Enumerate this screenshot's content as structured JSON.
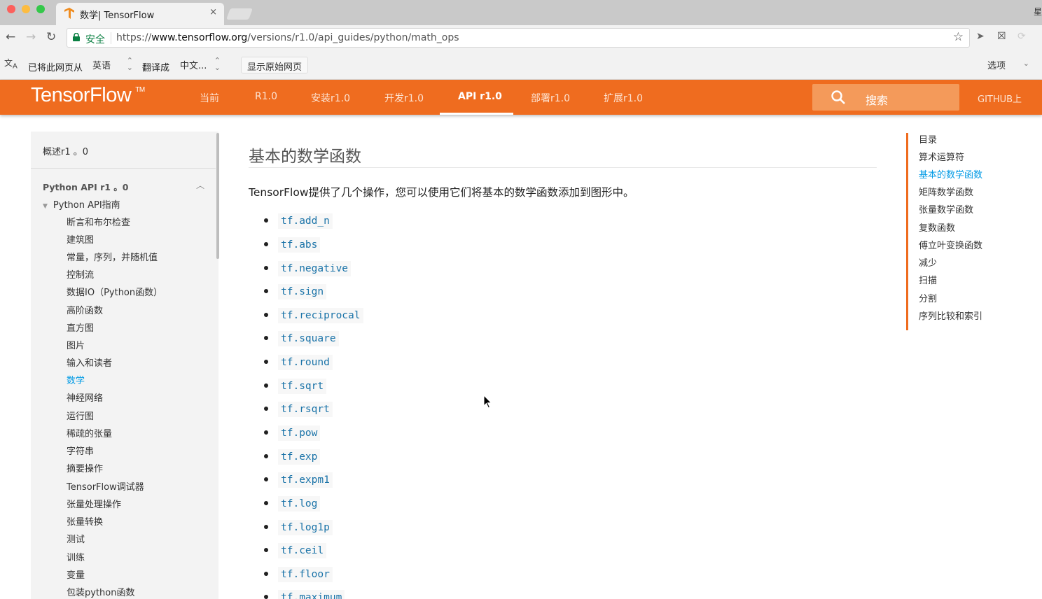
{
  "browser": {
    "tab_title": "数学| TensorFlow",
    "tab_close": "×",
    "corner_text": "星",
    "secure_label": "安全",
    "url_https": "https://",
    "url_domain": "www.tensorflow.org",
    "url_path": "/versions/r1.0/api_guides/python/math_ops",
    "star": "☆"
  },
  "translate_bar": {
    "prefix": "已将此网页从",
    "from_lang": "英语",
    "middle": "翻译成",
    "to_lang": "中文...",
    "show_original": "显示原始网页",
    "options": "选项"
  },
  "header": {
    "logo": "TensorFlow",
    "tm": "TM",
    "nav": [
      {
        "label": "当前"
      },
      {
        "label": "R1.0"
      },
      {
        "label": "安装r1.0"
      },
      {
        "label": "开发r1.0"
      },
      {
        "label": "API r1.0"
      },
      {
        "label": "部署r1.0"
      },
      {
        "label": "扩展r1.0"
      }
    ],
    "active_nav": "API r1.0",
    "search_placeholder": "搜索",
    "github": "GITHUB上"
  },
  "sidebar": {
    "overview": "概述r1 。0",
    "section": "Python API r1 。0",
    "guide": "Python API指南",
    "items": [
      "断言和布尔检查",
      "建筑图",
      "常量，序列，并随机值",
      "控制流",
      "数据IO（Python函数）",
      "高阶函数",
      "直方图",
      "图片",
      "输入和读者",
      "数学",
      "神经网络",
      "运行图",
      "稀疏的张量",
      "字符串",
      "摘要操作",
      "TensorFlow调试器",
      "张量处理操作",
      "张量转换",
      "测试",
      "训练",
      "变量",
      "包装python函数"
    ],
    "active_item": "数学"
  },
  "main": {
    "title": "基本的数学函数",
    "intro": "TensorFlow提供了几个操作，您可以使用它们将基本的数学函数添加到图形中。",
    "functions": [
      "tf.add_n",
      "tf.abs",
      "tf.negative",
      "tf.sign",
      "tf.reciprocal",
      "tf.square",
      "tf.round",
      "tf.sqrt",
      "tf.rsqrt",
      "tf.pow",
      "tf.exp",
      "tf.expm1",
      "tf.log",
      "tf.log1p",
      "tf.ceil",
      "tf.floor",
      "tf.maximum"
    ]
  },
  "toc": {
    "items": [
      "目录",
      "算术运算符",
      "基本的数学函数",
      "矩阵数学函数",
      "张量数学函数",
      "复数函数",
      "傅立叶变换函数",
      "减少",
      "扫描",
      "分割",
      "序列比较和索引"
    ],
    "active": "基本的数学函数"
  },
  "colors": {
    "brand_orange": "#ef6c1f",
    "link_blue": "#039be5",
    "code_blue": "#1a73a8",
    "secure_green": "#0b8043"
  }
}
